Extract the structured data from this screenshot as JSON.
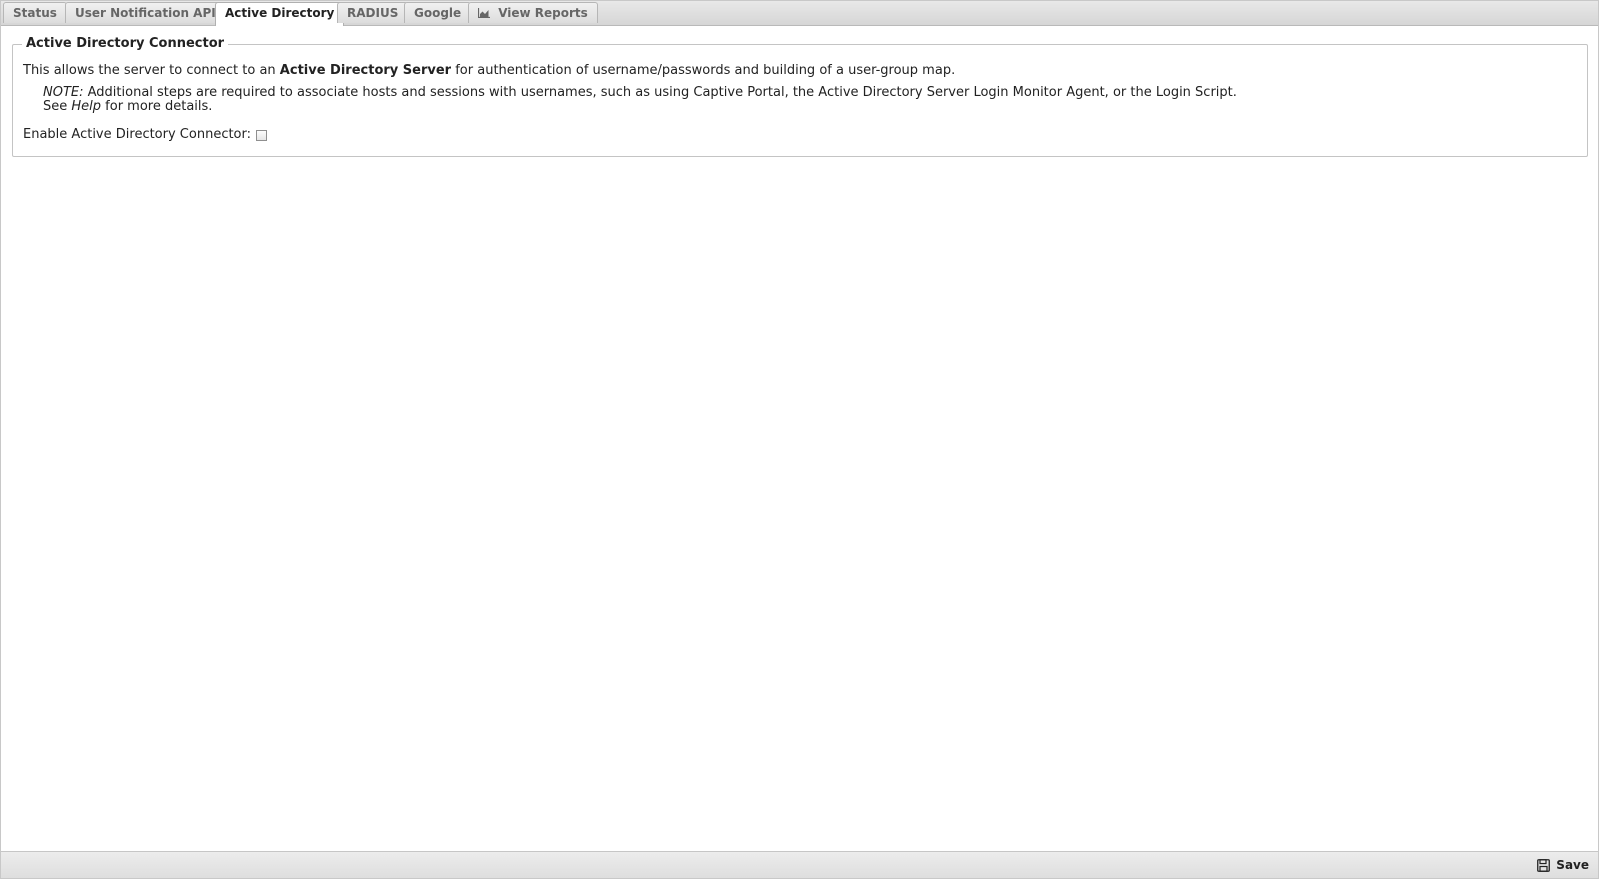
{
  "tabs": [
    {
      "label": "Status",
      "active": false
    },
    {
      "label": "User Notification API",
      "active": false
    },
    {
      "label": "Active Directory",
      "active": true
    },
    {
      "label": "RADIUS",
      "active": false
    },
    {
      "label": "Google",
      "active": false
    },
    {
      "label": "View Reports",
      "active": false,
      "icon": "chart-icon"
    }
  ],
  "panel": {
    "legend": "Active Directory Connector",
    "desc_before": "This allows the server to connect to an ",
    "desc_bold": "Active Directory Server",
    "desc_after": " for authentication of username/passwords and building of a user-group map.",
    "note_label": "NOTE:",
    "note_text": " Additional steps are required to associate hosts and sessions with usernames, such as using Captive Portal, the Active Directory Server Login Monitor Agent, or the Login Script.",
    "see_before": "See ",
    "see_link": "Help",
    "see_after": " for more details.",
    "enable_label": "Enable Active Directory Connector:",
    "enable_checked": false
  },
  "footer": {
    "save_label": "Save",
    "save_icon": "floppy-disk-icon"
  }
}
